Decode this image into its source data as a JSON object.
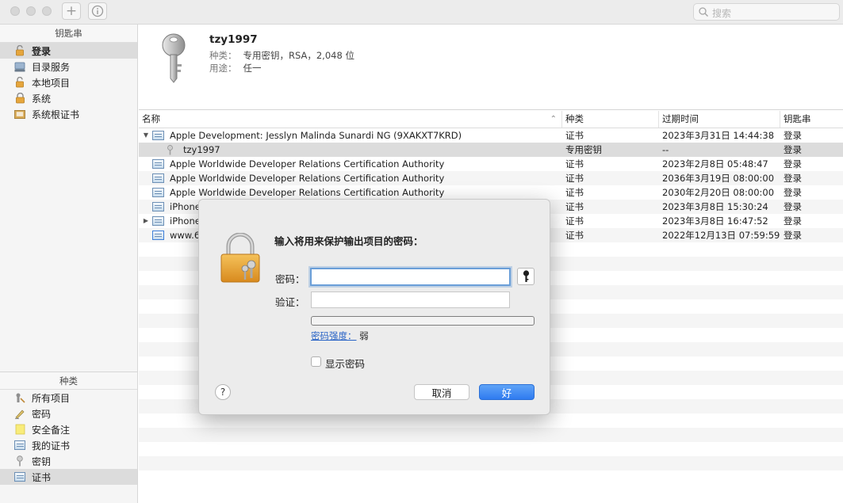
{
  "toolbar": {
    "add_label": "+",
    "info_label": "i",
    "search_placeholder": "搜索"
  },
  "sidebar": {
    "keychains_header": "钥匙串",
    "keychains": [
      {
        "label": "登录",
        "icon": "lock-open-icon"
      },
      {
        "label": "目录服务",
        "icon": "directory-icon"
      },
      {
        "label": "本地项目",
        "icon": "lock-open-icon"
      },
      {
        "label": "系统",
        "icon": "lock-icon"
      },
      {
        "label": "系统根证书",
        "icon": "cabinet-icon"
      }
    ],
    "category_header": "种类",
    "categories": [
      {
        "label": "所有项目",
        "icon": "all-items-icon"
      },
      {
        "label": "密码",
        "icon": "pencil-icon"
      },
      {
        "label": "安全备注",
        "icon": "note-icon"
      },
      {
        "label": "我的证书",
        "icon": "certificate-icon"
      },
      {
        "label": "密钥",
        "icon": "key-icon"
      },
      {
        "label": "证书",
        "icon": "certificate-icon"
      }
    ]
  },
  "info": {
    "name": "tzy1997",
    "kind_label": "种类：",
    "kind_value": "专用密钥，RSA，2,048 位",
    "usage_label": "用途：",
    "usage_value": "任一"
  },
  "table": {
    "headers": {
      "name": "名称",
      "kind": "种类",
      "expires": "过期时间",
      "keychain": "钥匙串"
    },
    "rows": [
      {
        "name": "Apple Development: Jesslyn Malinda Sunardi NG (9XAKXT7KRD)",
        "kind": "证书",
        "expires": "2023年3月31日 14:44:38",
        "keychain": "登录"
      },
      {
        "name": "tzy1997",
        "kind": "专用密钥",
        "expires": "--",
        "keychain": "登录"
      },
      {
        "name": "Apple Worldwide Developer Relations Certification Authority",
        "kind": "证书",
        "expires": "2023年2月8日 05:48:47",
        "keychain": "登录"
      },
      {
        "name": "Apple Worldwide Developer Relations Certification Authority",
        "kind": "证书",
        "expires": "2036年3月19日 08:00:00",
        "keychain": "登录"
      },
      {
        "name": "Apple Worldwide Developer Relations Certification Authority",
        "kind": "证书",
        "expires": "2030年2月20日 08:00:00",
        "keychain": "登录"
      },
      {
        "name": "iPhone",
        "kind": "证书",
        "expires": "2023年3月8日 15:30:24",
        "keychain": "登录"
      },
      {
        "name": "iPhone",
        "kind": "证书",
        "expires": "2023年3月8日 16:47:52",
        "keychain": "登录"
      },
      {
        "name": "www.6",
        "kind": "证书",
        "expires": "2022年12月13日 07:59:59",
        "keychain": "登录"
      }
    ]
  },
  "dialog": {
    "title": "输入将用来保护输出项目的密码：",
    "password_label": "密码：",
    "verify_label": "验证：",
    "strength_link": "密码强度：",
    "strength_value": "弱",
    "show_password": "显示密码",
    "help": "?",
    "cancel": "取消",
    "ok": "好"
  },
  "colors": {
    "accent": "#2f7bf0",
    "selection": "#dcdcdc",
    "link": "#2a64c6"
  }
}
